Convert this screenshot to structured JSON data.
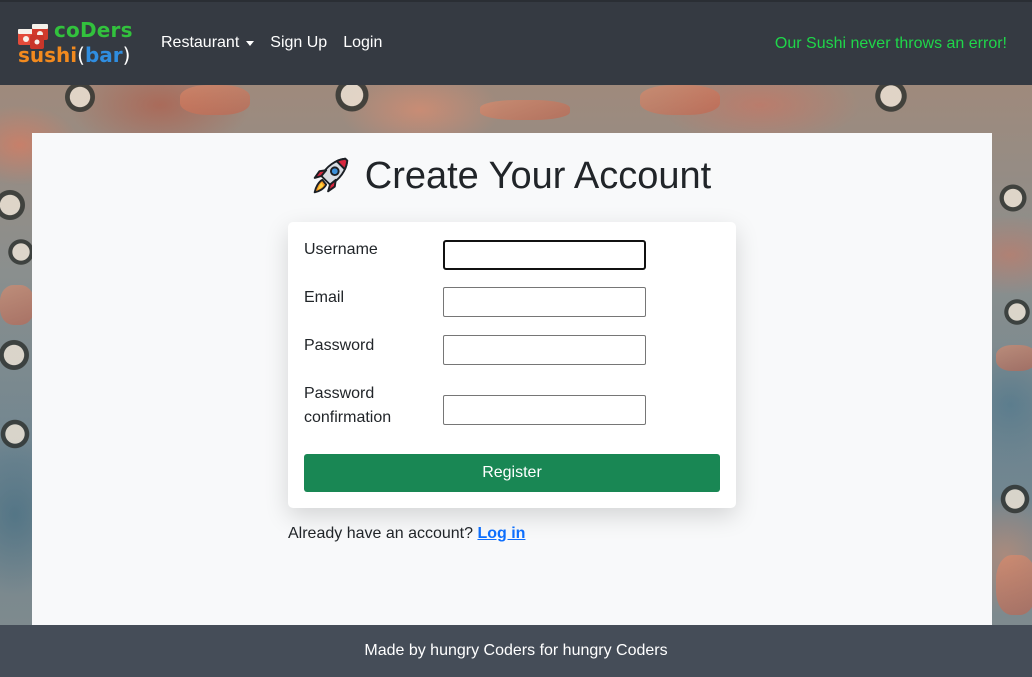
{
  "brand": {
    "logo_top": "coDers",
    "logo_bottom_main": "sushi",
    "logo_bottom_paren_open": "(",
    "logo_bottom_bar": "bar",
    "logo_bottom_paren_close": ")",
    "colors": {
      "green": "#32c23d",
      "orange": "#f28a1e",
      "blue": "#2f8de0"
    }
  },
  "navbar": {
    "links": [
      {
        "label": "Restaurant",
        "icon": "caret-down-icon"
      },
      {
        "label": "Sign Up"
      },
      {
        "label": "Login"
      }
    ],
    "tagline": "Our Sushi never throws an error!",
    "tagline_color": "#1fd64a"
  },
  "page": {
    "title": "Create Your Account",
    "title_icon": "rocket-icon"
  },
  "form": {
    "fields": [
      {
        "label": "Username",
        "value": ""
      },
      {
        "label": "Email",
        "value": ""
      },
      {
        "label": "Password",
        "value": ""
      },
      {
        "label_line1": "Password",
        "label_line2": "confirmation",
        "value": ""
      }
    ],
    "submit_label": "Register",
    "submit_color": "#198754"
  },
  "login_prompt": {
    "text": "Already have an account?",
    "link_label": "Log in"
  },
  "footer": {
    "text": "Made by hungry Coders for hungry Coders"
  }
}
